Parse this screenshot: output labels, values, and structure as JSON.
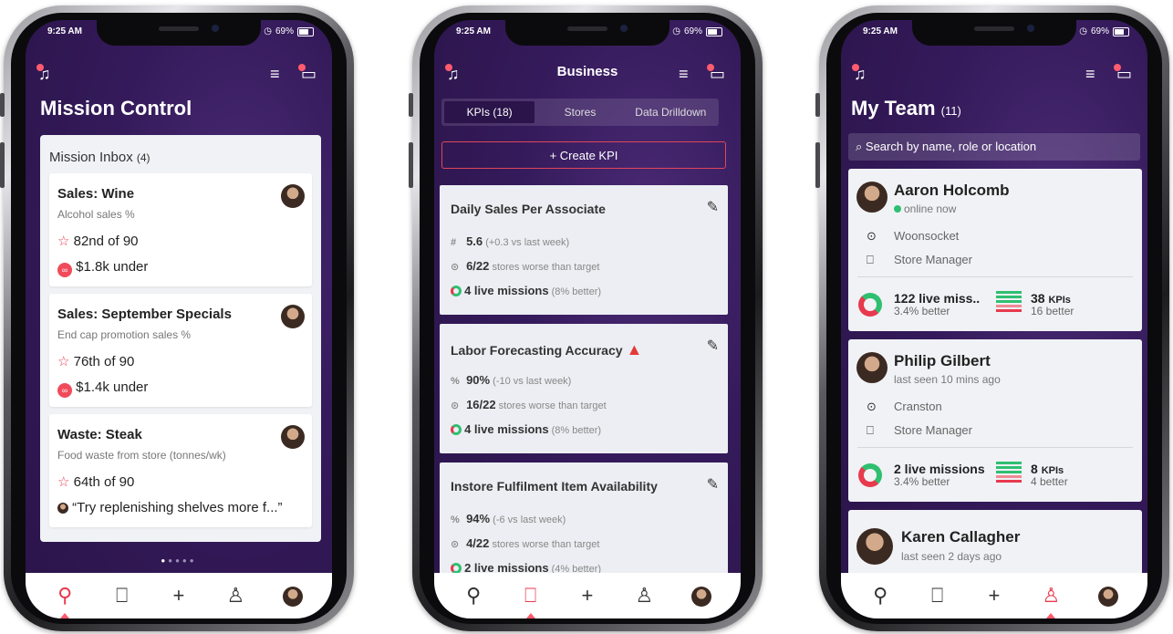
{
  "colors": {
    "purple": "#2a1449",
    "accent": "#ff5b6e",
    "green": "#2fbf71",
    "red": "#e8394d"
  },
  "status": {
    "time": "9:25 AM",
    "battery": "69%"
  },
  "icons": [
    "bell-icon",
    "filter-icon",
    "chat-icon",
    "rocket-icon",
    "briefcase-icon",
    "plus-icon",
    "person-icon",
    "avatar"
  ],
  "phone1": {
    "title": "Mission Control",
    "inbox_title": "Mission Inbox",
    "inbox_count": "(4)",
    "missions": [
      {
        "title": "Sales: Wine",
        "subtitle": "Alcohol sales %",
        "rank": "82nd of 90",
        "detail": "$1.8k under"
      },
      {
        "title": "Sales: September Specials",
        "subtitle": "End cap promotion sales %",
        "rank": "76th of 90",
        "detail": "$1.4k under"
      },
      {
        "title": "Waste: Steak",
        "subtitle": "Food waste from store (tonnes/wk)",
        "rank": "64th of 90",
        "detail": "“Try replenishing shelves more f...”"
      }
    ],
    "pager_total": 5,
    "pager_active": 1
  },
  "phone2": {
    "title": "Business",
    "tabs": [
      "KPIs (18)",
      "Stores",
      "Data Drilldown"
    ],
    "create_label": "+ Create KPI",
    "kpis": [
      {
        "title": "Daily Sales Per Associate",
        "value": "5.6",
        "value_note": "(+0.3 vs last week)",
        "stores": "6/22",
        "stores_note": "stores worse than target",
        "missions": "4 live missions",
        "missions_note": "(8% better)"
      },
      {
        "title": "Labor Forecasting Accuracy",
        "value": "90%",
        "value_note": "(-10 vs last week)",
        "stores": "16/22",
        "stores_note": "stores worse than target",
        "missions": "4 live missions",
        "missions_note": "(8% better)"
      },
      {
        "title": "Instore Fulfilment Item Availability",
        "value": "94%",
        "value_note": "(-6 vs last week)",
        "stores": "4/22",
        "stores_note": "stores worse than target",
        "missions": "2 live missions",
        "missions_note": "(4% better)"
      }
    ]
  },
  "phone3": {
    "title": "My Team",
    "count": "(11)",
    "search_placeholder": "Search by name, role or location",
    "members": [
      {
        "name": "Aaron Holcomb",
        "status": "online now",
        "location": "Woonsocket",
        "role": "Store Manager",
        "missions": "122 live miss..",
        "missions_note": "3.4% better",
        "kpis": "38",
        "kpis_unit": "KPIs",
        "kpis_note": "16 better"
      },
      {
        "name": "Philip Gilbert",
        "status": "last seen 10 mins ago",
        "location": "Cranston",
        "role": "Store Manager",
        "missions": "2 live missions",
        "missions_note": "3.4% better",
        "kpis": "8",
        "kpis_unit": "KPIs",
        "kpis_note": "4 better"
      },
      {
        "name": "Karen Callagher",
        "status": "last seen 2 days ago"
      }
    ]
  }
}
